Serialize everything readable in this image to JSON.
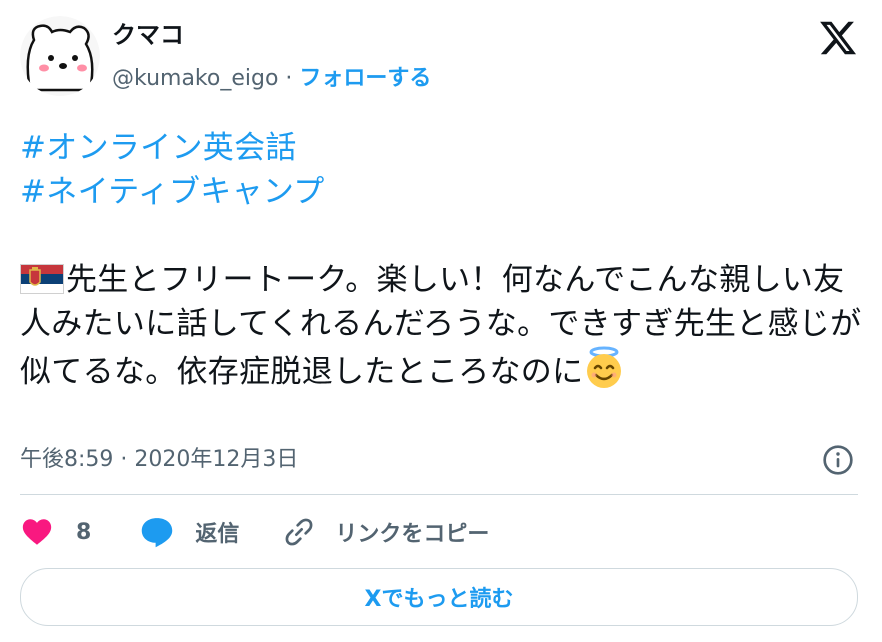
{
  "user": {
    "name": "クマコ",
    "handle": "@kumako_eigo",
    "separator": " · ",
    "follow_label": "フォローする"
  },
  "tweet": {
    "hashtags": [
      "#オンライン英会話",
      "#ネイティブキャンプ"
    ],
    "flag_icon": "serbia-flag-icon",
    "body": "先生とフリートーク。楽しい！何なんでこんな親しい友人みたいに話してくれるんだろうな。できすぎ先生と感じが似てるな。依存症脱退したところなのに",
    "emoji_icon": "smiling-face-with-halo-icon"
  },
  "meta": {
    "timestamp": "午後8:59 · 2020年12月3日"
  },
  "actions": {
    "like_count": "8",
    "reply_label": "返信",
    "copy_link_label": "リンクをコピー"
  },
  "read_more_label": "Xでもっと読む",
  "colors": {
    "accent": "#1d9bf0",
    "like": "#f91880",
    "text": "#0f1419",
    "secondary": "#536471",
    "border": "#cfd9de"
  }
}
